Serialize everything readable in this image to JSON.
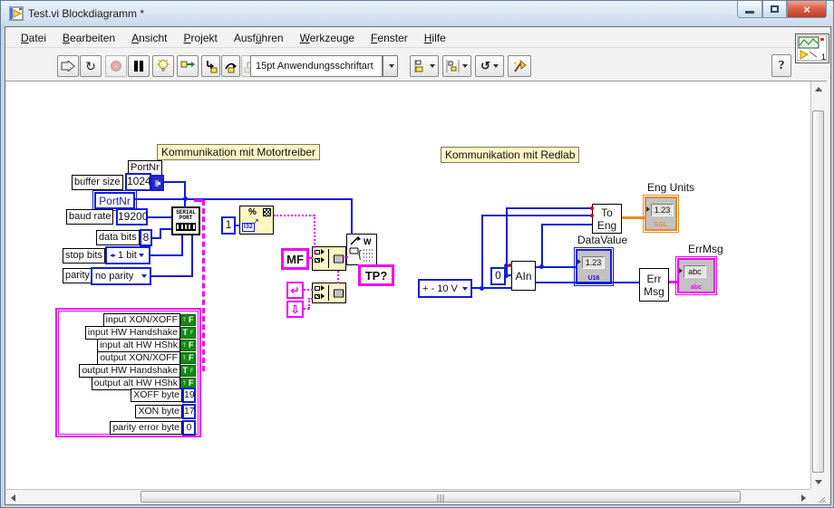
{
  "window": {
    "title": "Test.vi Blockdiagramm *",
    "controls": {
      "close_glyph": "×"
    }
  },
  "menu": {
    "items": [
      {
        "pre": "",
        "accel": "D",
        "post": "atei"
      },
      {
        "pre": "",
        "accel": "B",
        "post": "earbeiten"
      },
      {
        "pre": "",
        "accel": "A",
        "post": "nsicht"
      },
      {
        "pre": "",
        "accel": "P",
        "post": "rojekt"
      },
      {
        "pre": "Ausf",
        "accel": "ü",
        "post": "hren"
      },
      {
        "pre": "",
        "accel": "W",
        "post": "erkzeuge"
      },
      {
        "pre": "",
        "accel": "F",
        "post": "enster"
      },
      {
        "pre": "",
        "accel": "H",
        "post": "ilfe"
      }
    ]
  },
  "toolbar": {
    "font_selector": "15pt Anwendungsschriftart",
    "help_label": "?",
    "vi_icon_badge": "1"
  },
  "icons": {
    "left_right": "◂▸",
    "reorder": "↺",
    "run_continuous": "↻"
  },
  "diagram": {
    "labels": {
      "motor": "Kommunikation mit Motortreiber",
      "redlab": "Kommunikation mit Redlab"
    },
    "motor_section": {
      "portnr_free_label": "PortNr",
      "buffer_size_label": "buffer size",
      "buffer_size_value": "1024",
      "portnr_terminal": "PortNr",
      "baud_rate_label": "baud rate",
      "baud_rate_value": "19200",
      "data_bits_label": "data bits",
      "data_bits_value": "8",
      "stop_bits_label": "stop bits",
      "stop_bits_value": "1 bit",
      "parity_label": "parity",
      "parity_value": "no parity",
      "serial_port_node": "SERIAL\nPORT",
      "one_constant": "1",
      "format_node_type": "I32",
      "mf_constant": "MF",
      "tp_constant": "TP?",
      "cr_constant": "↵",
      "lf_constant": "⇩"
    },
    "cluster": {
      "rows": [
        {
          "label": "input XON/XOFF",
          "type": "bool",
          "value": "F"
        },
        {
          "label": "input HW Handshake",
          "type": "bool",
          "value": "T"
        },
        {
          "label": "input alt HW HShk",
          "type": "bool",
          "value": "F"
        },
        {
          "label": "output XON/XOFF",
          "type": "bool",
          "value": "F"
        },
        {
          "label": "output HW Handshake",
          "type": "bool",
          "value": "T"
        },
        {
          "label": "output alt HW HShk",
          "type": "bool",
          "value": "F"
        },
        {
          "label": "XOFF byte",
          "type": "num",
          "value": "19"
        },
        {
          "label": "XON byte",
          "type": "num",
          "value": "17"
        },
        {
          "label": "parity error byte",
          "type": "num",
          "value": "0"
        }
      ]
    },
    "redlab_section": {
      "range_ring": "+ - 10 V",
      "zero_constant": "0",
      "ain_node": "AIn",
      "to_eng_node": "To\nEng",
      "err_msg_node": "Err\nMsg",
      "eng_units": {
        "label": "Eng Units",
        "value": "1.23",
        "type": "SGL"
      },
      "data_value": {
        "label": "DataValue",
        "value": "1.23",
        "type": "U16"
      },
      "err_msg_indicator": {
        "label": "ErrMsg",
        "value": "abc",
        "type": "abc"
      }
    },
    "colors": {
      "wire_blue": "#0f1dd8",
      "magenta": "#f200f2",
      "orange": "#e88a20",
      "node_yellow": "#fdf6c3",
      "bool_green": "#128a12",
      "label_yellow": "#fdf5c6"
    }
  }
}
